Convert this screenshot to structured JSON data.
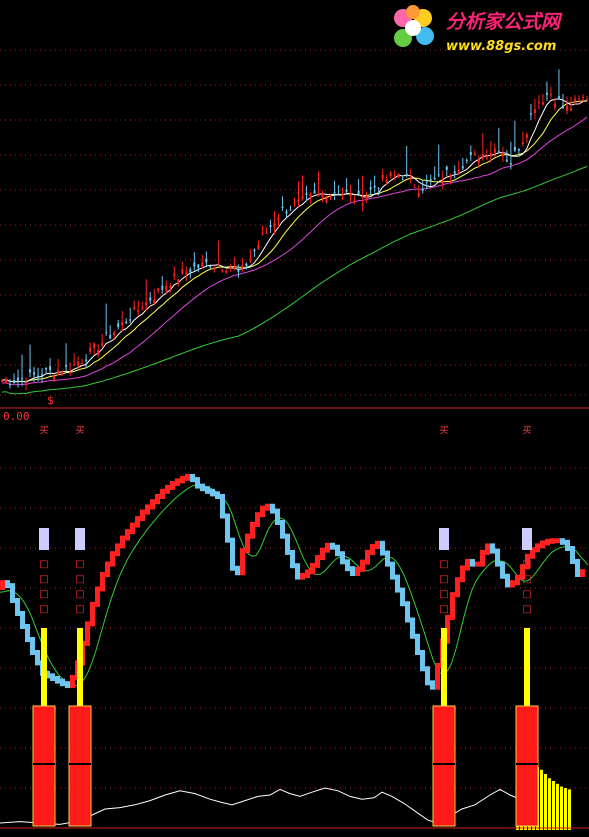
{
  "watermark": {
    "title": "分析家公式网",
    "url": "www.88gs.com"
  },
  "colors": {
    "background": "#000000",
    "up": "#ff2020",
    "down": "#6ec6f0",
    "ma_fast": "#ffffff",
    "ma_mid": "#ffff55",
    "ma_slow": "#dd44dd",
    "ma_long": "#33cc33",
    "grid": "#aa2222",
    "signal_bar": "#ffff00",
    "signal_block": "#ff1a1a",
    "signal_cap": "#ccccff",
    "histogram": "#ffff00",
    "osc_line": "#ffffff"
  },
  "chart_data": [
    {
      "type": "candlestick",
      "panel": "price",
      "trend": [
        [
          0,
          0.0
        ],
        [
          20,
          0.0
        ],
        [
          40,
          0.02
        ],
        [
          70,
          0.04
        ],
        [
          90,
          0.09
        ],
        [
          110,
          0.15
        ],
        [
          130,
          0.21
        ],
        [
          150,
          0.27
        ],
        [
          170,
          0.33
        ],
        [
          190,
          0.37
        ],
        [
          210,
          0.39
        ],
        [
          230,
          0.38
        ],
        [
          240,
          0.35
        ],
        [
          260,
          0.46
        ],
        [
          280,
          0.56
        ],
        [
          300,
          0.59
        ],
        [
          320,
          0.62
        ],
        [
          340,
          0.63
        ],
        [
          360,
          0.6
        ],
        [
          380,
          0.66
        ],
        [
          400,
          0.69
        ],
        [
          420,
          0.64
        ],
        [
          440,
          0.67
        ],
        [
          460,
          0.72
        ],
        [
          480,
          0.75
        ],
        [
          500,
          0.78
        ],
        [
          510,
          0.72
        ],
        [
          525,
          0.82
        ],
        [
          535,
          0.92
        ],
        [
          550,
          0.96
        ],
        [
          565,
          0.9
        ],
        [
          589,
          0.95
        ]
      ],
      "moving_averages": [
        "ma_fast",
        "ma_mid",
        "ma_slow",
        "ma_long"
      ],
      "marker": "$",
      "grid": true
    },
    {
      "type": "indicator",
      "panel": "lower",
      "axis_value_label": "0.00",
      "signal_label": "买",
      "signal_markers": [
        "□",
        "□",
        "□",
        "□"
      ],
      "curve": [
        [
          0,
          0.55
        ],
        [
          8,
          0.58
        ],
        [
          15,
          0.5
        ],
        [
          25,
          0.4
        ],
        [
          35,
          0.3
        ],
        [
          45,
          0.22
        ],
        [
          55,
          0.2
        ],
        [
          65,
          0.18
        ],
        [
          72,
          0.17
        ],
        [
          80,
          0.26
        ],
        [
          88,
          0.38
        ],
        [
          96,
          0.5
        ],
        [
          105,
          0.6
        ],
        [
          115,
          0.68
        ],
        [
          125,
          0.74
        ],
        [
          135,
          0.79
        ],
        [
          145,
          0.84
        ],
        [
          155,
          0.88
        ],
        [
          165,
          0.92
        ],
        [
          175,
          0.95
        ],
        [
          185,
          0.97
        ],
        [
          192,
          0.98
        ],
        [
          200,
          0.94
        ],
        [
          210,
          0.92
        ],
        [
          220,
          0.9
        ],
        [
          228,
          0.78
        ],
        [
          233,
          0.66
        ],
        [
          238,
          0.57
        ],
        [
          244,
          0.68
        ],
        [
          252,
          0.77
        ],
        [
          260,
          0.83
        ],
        [
          268,
          0.87
        ],
        [
          276,
          0.84
        ],
        [
          284,
          0.76
        ],
        [
          292,
          0.66
        ],
        [
          300,
          0.59
        ],
        [
          308,
          0.6
        ],
        [
          316,
          0.64
        ],
        [
          324,
          0.69
        ],
        [
          332,
          0.72
        ],
        [
          340,
          0.68
        ],
        [
          348,
          0.63
        ],
        [
          356,
          0.6
        ],
        [
          364,
          0.64
        ],
        [
          372,
          0.7
        ],
        [
          380,
          0.72
        ],
        [
          388,
          0.66
        ],
        [
          396,
          0.58
        ],
        [
          404,
          0.5
        ],
        [
          412,
          0.4
        ],
        [
          420,
          0.3
        ],
        [
          428,
          0.2
        ],
        [
          434,
          0.15
        ],
        [
          440,
          0.25
        ],
        [
          448,
          0.4
        ],
        [
          456,
          0.54
        ],
        [
          464,
          0.62
        ],
        [
          472,
          0.66
        ],
        [
          478,
          0.62
        ],
        [
          484,
          0.68
        ],
        [
          492,
          0.72
        ],
        [
          498,
          0.66
        ],
        [
          504,
          0.6
        ],
        [
          510,
          0.56
        ],
        [
          516,
          0.57
        ],
        [
          522,
          0.6
        ],
        [
          528,
          0.66
        ],
        [
          536,
          0.7
        ],
        [
          544,
          0.72
        ],
        [
          552,
          0.73
        ],
        [
          560,
          0.73
        ],
        [
          568,
          0.72
        ],
        [
          574,
          0.66
        ],
        [
          580,
          0.6
        ],
        [
          589,
          0.62
        ]
      ],
      "signal_x": [
        44,
        80,
        444,
        527
      ],
      "osc_line": [
        [
          0,
          0.1
        ],
        [
          20,
          0.12
        ],
        [
          40,
          0.1
        ],
        [
          60,
          0.08
        ],
        [
          75,
          0.12
        ],
        [
          90,
          0.2
        ],
        [
          105,
          0.3
        ],
        [
          120,
          0.32
        ],
        [
          135,
          0.36
        ],
        [
          150,
          0.42
        ],
        [
          165,
          0.5
        ],
        [
          180,
          0.56
        ],
        [
          195,
          0.52
        ],
        [
          210,
          0.44
        ],
        [
          220,
          0.4
        ],
        [
          232,
          0.36
        ],
        [
          245,
          0.42
        ],
        [
          258,
          0.48
        ],
        [
          270,
          0.5
        ],
        [
          280,
          0.58
        ],
        [
          290,
          0.52
        ],
        [
          300,
          0.48
        ],
        [
          312,
          0.54
        ],
        [
          325,
          0.6
        ],
        [
          338,
          0.56
        ],
        [
          350,
          0.48
        ],
        [
          362,
          0.44
        ],
        [
          374,
          0.46
        ],
        [
          382,
          0.54
        ],
        [
          392,
          0.48
        ],
        [
          404,
          0.38
        ],
        [
          416,
          0.26
        ],
        [
          428,
          0.14
        ],
        [
          438,
          0.1
        ],
        [
          450,
          0.2
        ],
        [
          462,
          0.3
        ],
        [
          475,
          0.36
        ],
        [
          490,
          0.5
        ],
        [
          500,
          0.58
        ],
        [
          510,
          0.5
        ],
        [
          520,
          0.44
        ]
      ],
      "histogram": [
        [
          516,
          0.25
        ],
        [
          520,
          0.45
        ],
        [
          524,
          0.62
        ],
        [
          528,
          0.7
        ],
        [
          532,
          0.82
        ],
        [
          536,
          0.9
        ],
        [
          540,
          0.86
        ],
        [
          544,
          0.8
        ],
        [
          548,
          0.74
        ],
        [
          552,
          0.7
        ],
        [
          556,
          0.66
        ],
        [
          560,
          0.62
        ],
        [
          564,
          0.6
        ],
        [
          568,
          0.58
        ]
      ]
    }
  ]
}
